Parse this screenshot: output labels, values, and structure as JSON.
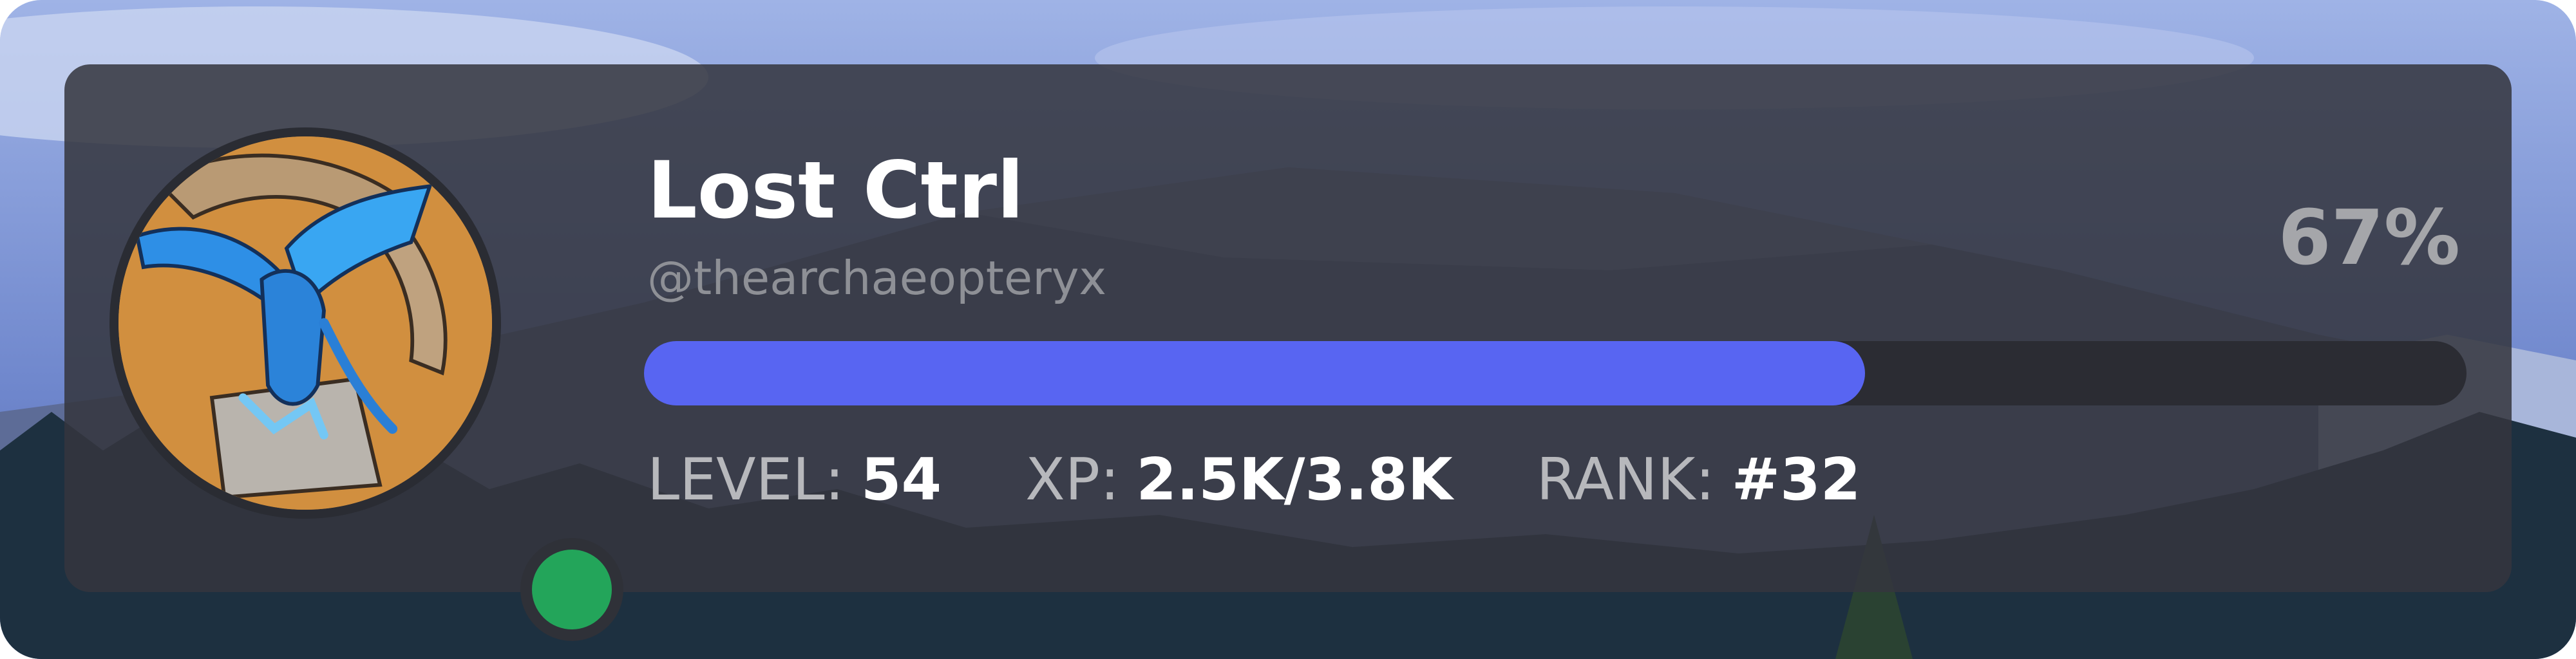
{
  "profile": {
    "display_name": "Lost Ctrl",
    "handle": "@thearchaeopteryx",
    "status": "online",
    "status_color": "#23a55a",
    "avatar_icon": "bird-avatar-icon"
  },
  "progress": {
    "percent_label": "67%",
    "fraction": 0.67,
    "fill_color": "#5865f2"
  },
  "stats": {
    "level_label": "LEVEL:",
    "level_value": "54",
    "xp_label": "XP:",
    "xp_value": "2.5K/3.8K",
    "rank_label": "RANK:",
    "rank_value": "#32"
  }
}
